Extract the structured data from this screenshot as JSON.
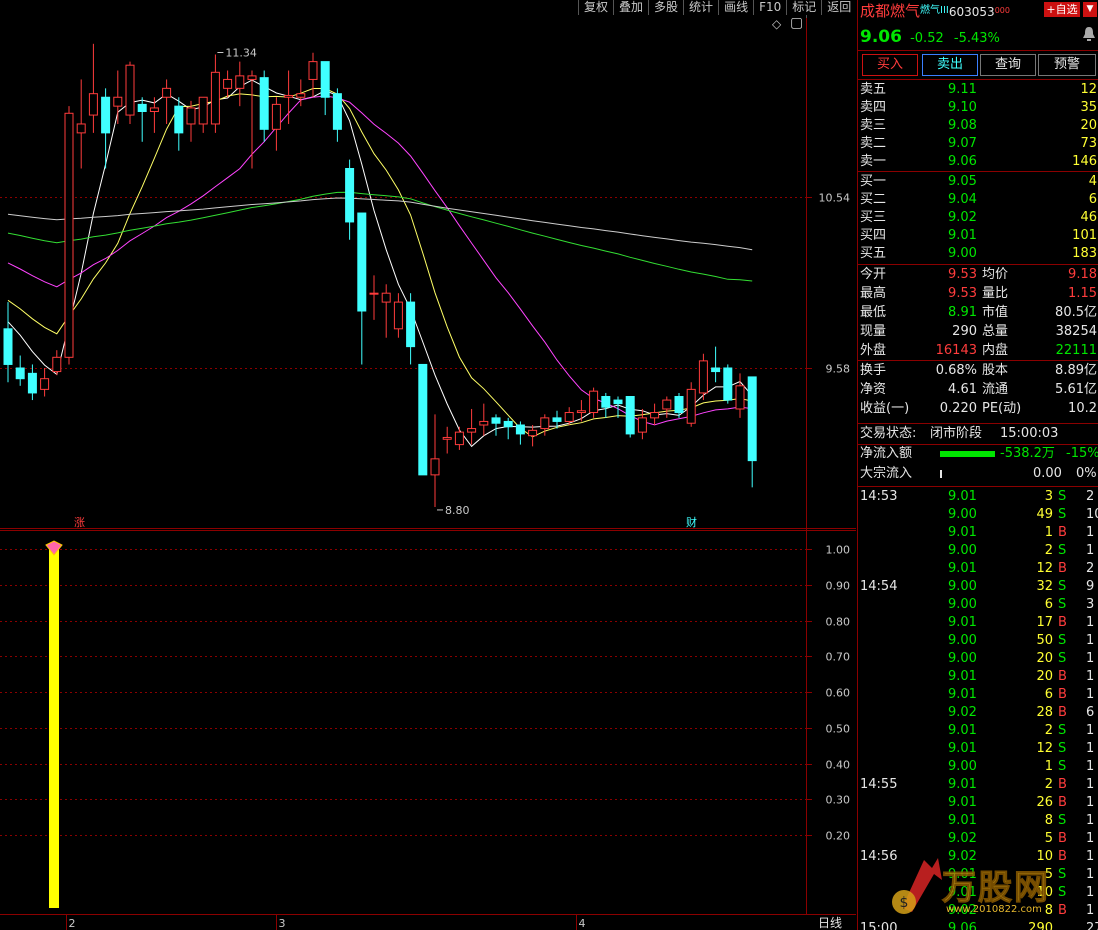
{
  "toolbar": [
    "复权",
    "叠加",
    "多股",
    "统计",
    "画线",
    "F10",
    "标记",
    "返回"
  ],
  "chart": {
    "price_labels": [
      "10.54",
      "9.58"
    ],
    "high_label": "11.34",
    "low_label": "8.80",
    "marker_zhang": "涨",
    "marker_cai": "财",
    "indicator_ticks": [
      "1.00",
      "0.90",
      "0.80",
      "0.70",
      "0.60",
      "0.50",
      "0.40",
      "0.30",
      "0.20"
    ],
    "x_ticks": [
      "2",
      "3",
      "4"
    ],
    "period_label": "日线",
    "diamond_glyph": "◇",
    "square_glyph": "▢"
  },
  "chart_data": {
    "type": "candlestick",
    "candles": [
      {
        "o": 9.8,
        "c": 9.6,
        "h": 9.95,
        "l": 9.5
      },
      {
        "o": 9.58,
        "c": 9.52,
        "h": 9.65,
        "l": 9.48
      },
      {
        "o": 9.55,
        "c": 9.44,
        "h": 9.6,
        "l": 9.4
      },
      {
        "o": 9.46,
        "c": 9.52,
        "h": 9.58,
        "l": 9.42
      },
      {
        "o": 9.56,
        "c": 9.64,
        "h": 9.68,
        "l": 9.54
      },
      {
        "o": 9.64,
        "c": 11.01,
        "h": 11.05,
        "l": 9.6
      },
      {
        "o": 10.9,
        "c": 10.95,
        "h": 11.2,
        "l": 10.7
      },
      {
        "o": 11.0,
        "c": 11.12,
        "h": 11.4,
        "l": 10.9
      },
      {
        "o": 11.1,
        "c": 10.9,
        "h": 11.15,
        "l": 10.7
      },
      {
        "o": 11.05,
        "c": 11.1,
        "h": 11.25,
        "l": 10.95
      },
      {
        "o": 11.0,
        "c": 11.28,
        "h": 11.3,
        "l": 10.95
      },
      {
        "o": 11.06,
        "c": 11.02,
        "h": 11.1,
        "l": 10.85
      },
      {
        "o": 11.02,
        "c": 11.04,
        "h": 11.1,
        "l": 10.9
      },
      {
        "o": 11.1,
        "c": 11.15,
        "h": 11.2,
        "l": 10.95
      },
      {
        "o": 11.05,
        "c": 10.9,
        "h": 11.1,
        "l": 10.8
      },
      {
        "o": 10.95,
        "c": 11.04,
        "h": 11.08,
        "l": 10.85
      },
      {
        "o": 10.95,
        "c": 11.1,
        "h": 11.1,
        "l": 10.9
      },
      {
        "o": 10.95,
        "c": 11.24,
        "h": 11.34,
        "l": 10.9
      },
      {
        "o": 11.15,
        "c": 11.2,
        "h": 11.25,
        "l": 11.1
      },
      {
        "o": 11.15,
        "c": 11.22,
        "h": 11.3,
        "l": 11.05
      },
      {
        "o": 11.2,
        "c": 11.22,
        "h": 11.25,
        "l": 10.7
      },
      {
        "o": 11.21,
        "c": 10.92,
        "h": 11.25,
        "l": 10.85
      },
      {
        "o": 10.92,
        "c": 11.06,
        "h": 11.1,
        "l": 10.8
      },
      {
        "o": 11.1,
        "c": 11.11,
        "h": 11.25,
        "l": 10.95
      },
      {
        "o": 11.1,
        "c": 11.12,
        "h": 11.2,
        "l": 11.05
      },
      {
        "o": 11.2,
        "c": 11.3,
        "h": 11.35,
        "l": 11.1
      },
      {
        "o": 11.3,
        "c": 11.1,
        "h": 11.3,
        "l": 11.0
      },
      {
        "o": 11.12,
        "c": 10.92,
        "h": 11.15,
        "l": 10.85
      },
      {
        "o": 10.7,
        "c": 10.4,
        "h": 10.75,
        "l": 10.3
      },
      {
        "o": 10.45,
        "c": 9.9,
        "h": 10.45,
        "l": 9.6
      },
      {
        "o": 10.0,
        "c": 10.0,
        "h": 10.1,
        "l": 9.85
      },
      {
        "o": 9.95,
        "c": 10.0,
        "h": 10.05,
        "l": 9.75
      },
      {
        "o": 9.8,
        "c": 9.95,
        "h": 10.0,
        "l": 9.75
      },
      {
        "o": 9.95,
        "c": 9.7,
        "h": 10.0,
        "l": 9.6
      },
      {
        "o": 9.6,
        "c": 8.98,
        "h": 9.6,
        "l": 8.98
      },
      {
        "o": 8.98,
        "c": 9.07,
        "h": 9.32,
        "l": 8.8
      },
      {
        "o": 9.18,
        "c": 9.19,
        "h": 9.25,
        "l": 9.1
      },
      {
        "o": 9.15,
        "c": 9.22,
        "h": 9.25,
        "l": 9.12
      },
      {
        "o": 9.22,
        "c": 9.24,
        "h": 9.35,
        "l": 9.15
      },
      {
        "o": 9.26,
        "c": 9.28,
        "h": 9.38,
        "l": 9.2
      },
      {
        "o": 9.3,
        "c": 9.27,
        "h": 9.32,
        "l": 9.2
      },
      {
        "o": 9.28,
        "c": 9.25,
        "h": 9.3,
        "l": 9.18
      },
      {
        "o": 9.26,
        "c": 9.21,
        "h": 9.28,
        "l": 9.15
      },
      {
        "o": 9.2,
        "c": 9.23,
        "h": 9.26,
        "l": 9.14
      },
      {
        "o": 9.24,
        "c": 9.3,
        "h": 9.32,
        "l": 9.2
      },
      {
        "o": 9.3,
        "c": 9.28,
        "h": 9.34,
        "l": 9.24
      },
      {
        "o": 9.28,
        "c": 9.33,
        "h": 9.36,
        "l": 9.26
      },
      {
        "o": 9.33,
        "c": 9.34,
        "h": 9.4,
        "l": 9.28
      },
      {
        "o": 9.33,
        "c": 9.45,
        "h": 9.47,
        "l": 9.3
      },
      {
        "o": 9.42,
        "c": 9.36,
        "h": 9.44,
        "l": 9.3
      },
      {
        "o": 9.4,
        "c": 9.38,
        "h": 9.42,
        "l": 9.3
      },
      {
        "o": 9.42,
        "c": 9.21,
        "h": 9.42,
        "l": 9.19
      },
      {
        "o": 9.22,
        "c": 9.3,
        "h": 9.35,
        "l": 9.18
      },
      {
        "o": 9.3,
        "c": 9.33,
        "h": 9.38,
        "l": 9.26
      },
      {
        "o": 9.35,
        "c": 9.4,
        "h": 9.42,
        "l": 9.3
      },
      {
        "o": 9.42,
        "c": 9.33,
        "h": 9.44,
        "l": 9.3
      },
      {
        "o": 9.27,
        "c": 9.46,
        "h": 9.5,
        "l": 9.25
      },
      {
        "o": 9.44,
        "c": 9.62,
        "h": 9.66,
        "l": 9.4
      },
      {
        "o": 9.58,
        "c": 9.56,
        "h": 9.7,
        "l": 9.5
      },
      {
        "o": 9.58,
        "c": 9.4,
        "h": 9.6,
        "l": 9.38
      },
      {
        "o": 9.35,
        "c": 9.48,
        "h": 9.55,
        "l": 9.3
      },
      {
        "o": 9.53,
        "c": 9.06,
        "h": 9.53,
        "l": 8.91
      }
    ],
    "indicator": {
      "value": 1.0,
      "range": [
        0.1,
        1.0
      ]
    }
  },
  "stock": {
    "name": "成都燃气",
    "name_suffix": "燃气III",
    "code": "603053",
    "code_suffix": "000",
    "add_button": "+自选",
    "price": "9.06",
    "change": "-0.52",
    "pct": "-5.43%"
  },
  "trade_buttons": [
    "买入",
    "卖出",
    "查询",
    "预警"
  ],
  "asks": [
    {
      "label": "卖五",
      "price": "9.11",
      "vol": "12"
    },
    {
      "label": "卖四",
      "price": "9.10",
      "vol": "35"
    },
    {
      "label": "卖三",
      "price": "9.08",
      "vol": "20"
    },
    {
      "label": "卖二",
      "price": "9.07",
      "vol": "73"
    },
    {
      "label": "卖一",
      "price": "9.06",
      "vol": "146"
    }
  ],
  "bids": [
    {
      "label": "买一",
      "price": "9.05",
      "vol": "4"
    },
    {
      "label": "买二",
      "price": "9.04",
      "vol": "6"
    },
    {
      "label": "买三",
      "price": "9.02",
      "vol": "46"
    },
    {
      "label": "买四",
      "price": "9.01",
      "vol": "101"
    },
    {
      "label": "买五",
      "price": "9.00",
      "vol": "183"
    }
  ],
  "stats": [
    {
      "l1": "今开",
      "v1": "9.53",
      "l2": "均价",
      "v2": "9.18",
      "c1": "red",
      "c2": "red"
    },
    {
      "l1": "最高",
      "v1": "9.53",
      "l2": "量比",
      "v2": "1.15",
      "c1": "red",
      "c2": "red"
    },
    {
      "l1": "最低",
      "v1": "8.91",
      "l2": "市值",
      "v2": "80.5亿",
      "c1": "green",
      "c2": "white"
    },
    {
      "l1": "现量",
      "v1": "290",
      "l2": "总量",
      "v2": "38254",
      "c1": "white",
      "c2": "white"
    },
    {
      "l1": "外盘",
      "v1": "16143",
      "l2": "内盘",
      "v2": "22111",
      "c1": "red",
      "c2": "green"
    }
  ],
  "stats2": [
    {
      "l1": "换手",
      "v1": "0.68%",
      "l2": "股本",
      "v2": "8.89亿"
    },
    {
      "l1": "净资",
      "v1": "4.61",
      "l2": "流通",
      "v2": "5.61亿"
    },
    {
      "l1": "收益(一)",
      "v1": "0.220",
      "l2": "PE(动)",
      "v2": "10.2"
    }
  ],
  "status": {
    "label": "交易状态:",
    "value": "闭市阶段",
    "time": "15:00:03"
  },
  "flow": {
    "label": "净流入额",
    "value": "-538.2万",
    "pct": "-15%"
  },
  "block": {
    "label": "大宗流入",
    "value": "0.00",
    "pct": "0%"
  },
  "ticks": [
    {
      "t": "14:53",
      "p": "9.01",
      "v": "3",
      "s": "S",
      "n": "2"
    },
    {
      "t": "",
      "p": "9.00",
      "v": "49",
      "s": "S",
      "n": "10"
    },
    {
      "t": "",
      "p": "9.01",
      "v": "1",
      "s": "B",
      "n": "1"
    },
    {
      "t": "",
      "p": "9.00",
      "v": "2",
      "s": "S",
      "n": "1"
    },
    {
      "t": "",
      "p": "9.01",
      "v": "12",
      "s": "B",
      "n": "2"
    },
    {
      "t": "14:54",
      "p": "9.00",
      "v": "32",
      "s": "S",
      "n": "9"
    },
    {
      "t": "",
      "p": "9.00",
      "v": "6",
      "s": "S",
      "n": "3"
    },
    {
      "t": "",
      "p": "9.01",
      "v": "17",
      "s": "B",
      "n": "1"
    },
    {
      "t": "",
      "p": "9.00",
      "v": "50",
      "s": "S",
      "n": "1"
    },
    {
      "t": "",
      "p": "9.00",
      "v": "20",
      "s": "S",
      "n": "1"
    },
    {
      "t": "",
      "p": "9.01",
      "v": "20",
      "s": "B",
      "n": "1"
    },
    {
      "t": "",
      "p": "9.01",
      "v": "6",
      "s": "B",
      "n": "1"
    },
    {
      "t": "",
      "p": "9.02",
      "v": "28",
      "s": "B",
      "n": "6"
    },
    {
      "t": "",
      "p": "9.01",
      "v": "2",
      "s": "S",
      "n": "1"
    },
    {
      "t": "",
      "p": "9.01",
      "v": "12",
      "s": "S",
      "n": "1"
    },
    {
      "t": "",
      "p": "9.00",
      "v": "1",
      "s": "S",
      "n": "1"
    },
    {
      "t": "14:55",
      "p": "9.01",
      "v": "2",
      "s": "B",
      "n": "1"
    },
    {
      "t": "",
      "p": "9.01",
      "v": "26",
      "s": "B",
      "n": "1"
    },
    {
      "t": "",
      "p": "9.01",
      "v": "8",
      "s": "S",
      "n": "1"
    },
    {
      "t": "",
      "p": "9.02",
      "v": "5",
      "s": "B",
      "n": "1"
    },
    {
      "t": "14:56",
      "p": "9.02",
      "v": "10",
      "s": "B",
      "n": "1"
    },
    {
      "t": "",
      "p": "9.01",
      "v": "5",
      "s": "S",
      "n": "1"
    },
    {
      "t": "",
      "p": "9.01",
      "v": "10",
      "s": "S",
      "n": "1"
    },
    {
      "t": "",
      "p": "9.02",
      "v": "8",
      "s": "B",
      "n": "1"
    },
    {
      "t": "15:00",
      "p": "9.06",
      "v": "290",
      "s": "",
      "n": "27"
    }
  ],
  "watermark": {
    "text": "万股网",
    "url": "www.2010822.com"
  },
  "colors": {
    "up": "#ff3c3c",
    "down": "#40ffff",
    "ma5": "#ffffff",
    "ma10": "#ffff66",
    "ma20": "#ff44ff",
    "ma60": "#33dd33",
    "ma120": "#cccccc",
    "indicator": "#ffff00",
    "grid": "#8b0000"
  }
}
